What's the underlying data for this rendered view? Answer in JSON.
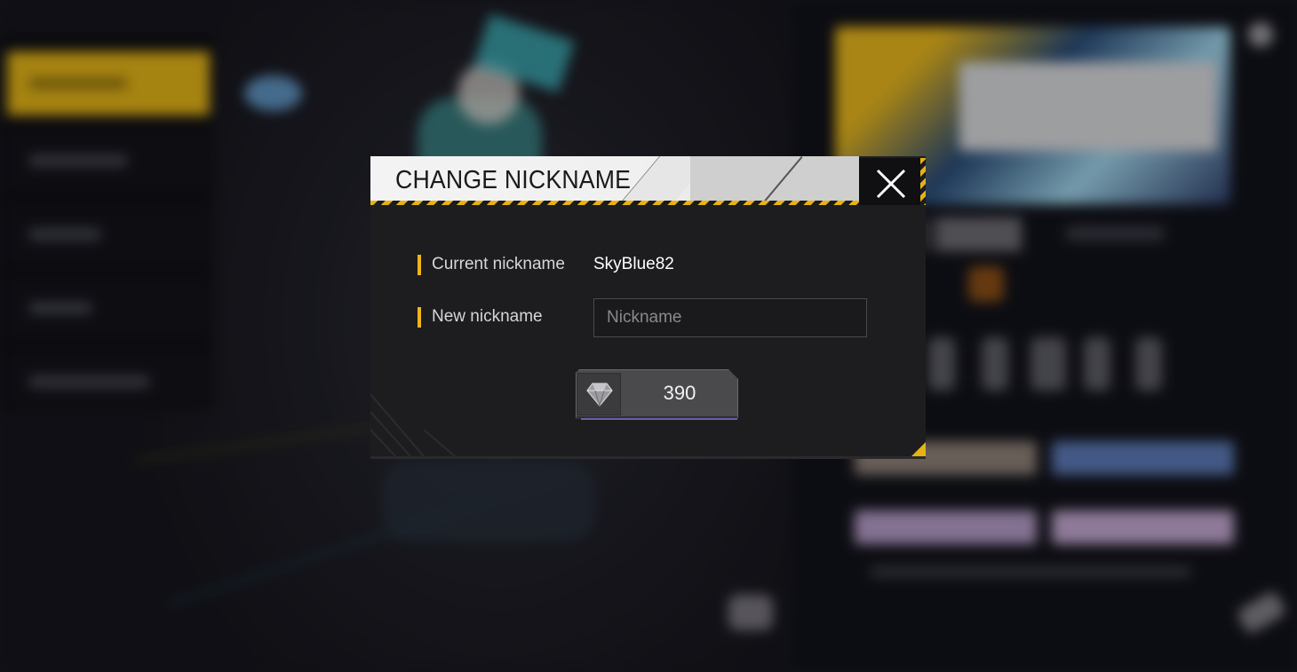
{
  "dialog": {
    "title": "CHANGE NICKNAME",
    "current_label": "Current nickname",
    "current_value": "SkyBlue82",
    "new_label": "New nickname",
    "new_input": {
      "value": "",
      "placeholder": "Nickname"
    },
    "cost": {
      "amount": "390",
      "currency_icon": "diamond-icon"
    },
    "close_icon": "close-icon"
  },
  "colors": {
    "accent": "#f0b51c",
    "panel": "#1d1d1f",
    "header": "#f0f0f0"
  }
}
